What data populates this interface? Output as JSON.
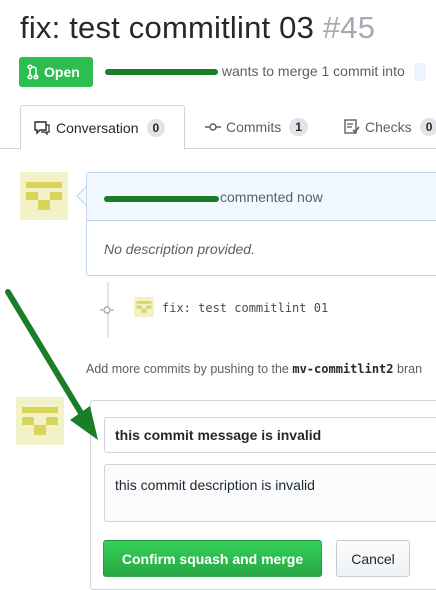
{
  "pr": {
    "title": "fix: test commitlint 03",
    "number": "#45",
    "state": "Open",
    "merge_text": "wants to merge 1 commit into"
  },
  "tabs": [
    {
      "label": "Conversation",
      "count": "0",
      "icon": "comment-icon"
    },
    {
      "label": "Commits",
      "count": "1",
      "icon": "commit-icon"
    },
    {
      "label": "Checks",
      "count": "0",
      "icon": "checklist-icon"
    }
  ],
  "comment": {
    "action": "commented now",
    "body": "No description provided."
  },
  "commit": {
    "message": "fix: test commitlint 01"
  },
  "push_hint": {
    "prefix": "Add more commits by pushing to the",
    "branch": "mv-commitlint2",
    "suffix": "bran"
  },
  "merge": {
    "commit_message": "this commit message is invalid",
    "commit_description": "this commit description is invalid",
    "confirm_label": "Confirm squash and merge",
    "cancel_label": "Cancel"
  },
  "colors": {
    "open_badge": "#2cbe4e",
    "confirm_button": "#28a745",
    "annotation_arrow": "#1b7d27"
  }
}
